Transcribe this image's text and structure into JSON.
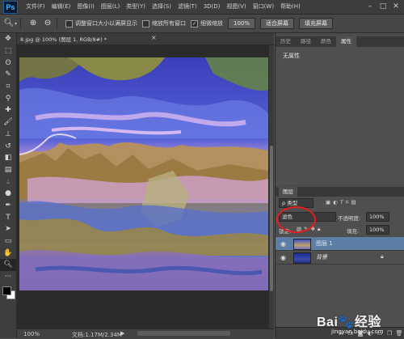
{
  "app": {
    "logo": "Ps"
  },
  "menubar": {
    "items": [
      "文件(F)",
      "编辑(E)",
      "图像(I)",
      "图层(L)",
      "类型(Y)",
      "选择(S)",
      "滤镜(T)",
      "3D(D)",
      "视图(V)",
      "窗口(W)",
      "帮助(H)"
    ],
    "window_controls": [
      "–",
      "□",
      "✕"
    ]
  },
  "options": {
    "tool_icon": "zoom-icon",
    "checkbox1_label": "调整窗口大小以满屏显示",
    "checkbox2_label": "缩放所有窗口",
    "checkbox3_label": "细微缩放",
    "checkbox3_checked": true,
    "btn_100": "100%",
    "btn_fit": "适合屏幕",
    "btn_fill": "填充屏幕"
  },
  "document": {
    "tab_label": "8.jpg @ 100% (图层 1, RGB/8#) *",
    "close": "×"
  },
  "status": {
    "zoom": "100%",
    "doc_size": "文档:1.17M/2.34M",
    "arrow": "▶"
  },
  "properties_panel": {
    "tabs": [
      "历史",
      "路径",
      "颜色",
      "属性"
    ],
    "active_tab": 3,
    "body_text": "无属性"
  },
  "layers_panel": {
    "tab": "图层",
    "filter_label": "ρ 类型",
    "blend_mode": "滤色",
    "opacity_label": "不透明度:",
    "opacity_value": "100%",
    "lock_label": "锁定:",
    "fill_label": "填充:",
    "fill_value": "100%",
    "layers": [
      {
        "name": "图层 1",
        "selected": true
      },
      {
        "name": "背景",
        "locked": true
      }
    ]
  },
  "watermark": {
    "brand": "Bai🐾经验",
    "url": "jingyan.baidu.com"
  },
  "colors": {
    "selected_layer": "#5d7fa6",
    "annotation_circle": "#e02020"
  }
}
